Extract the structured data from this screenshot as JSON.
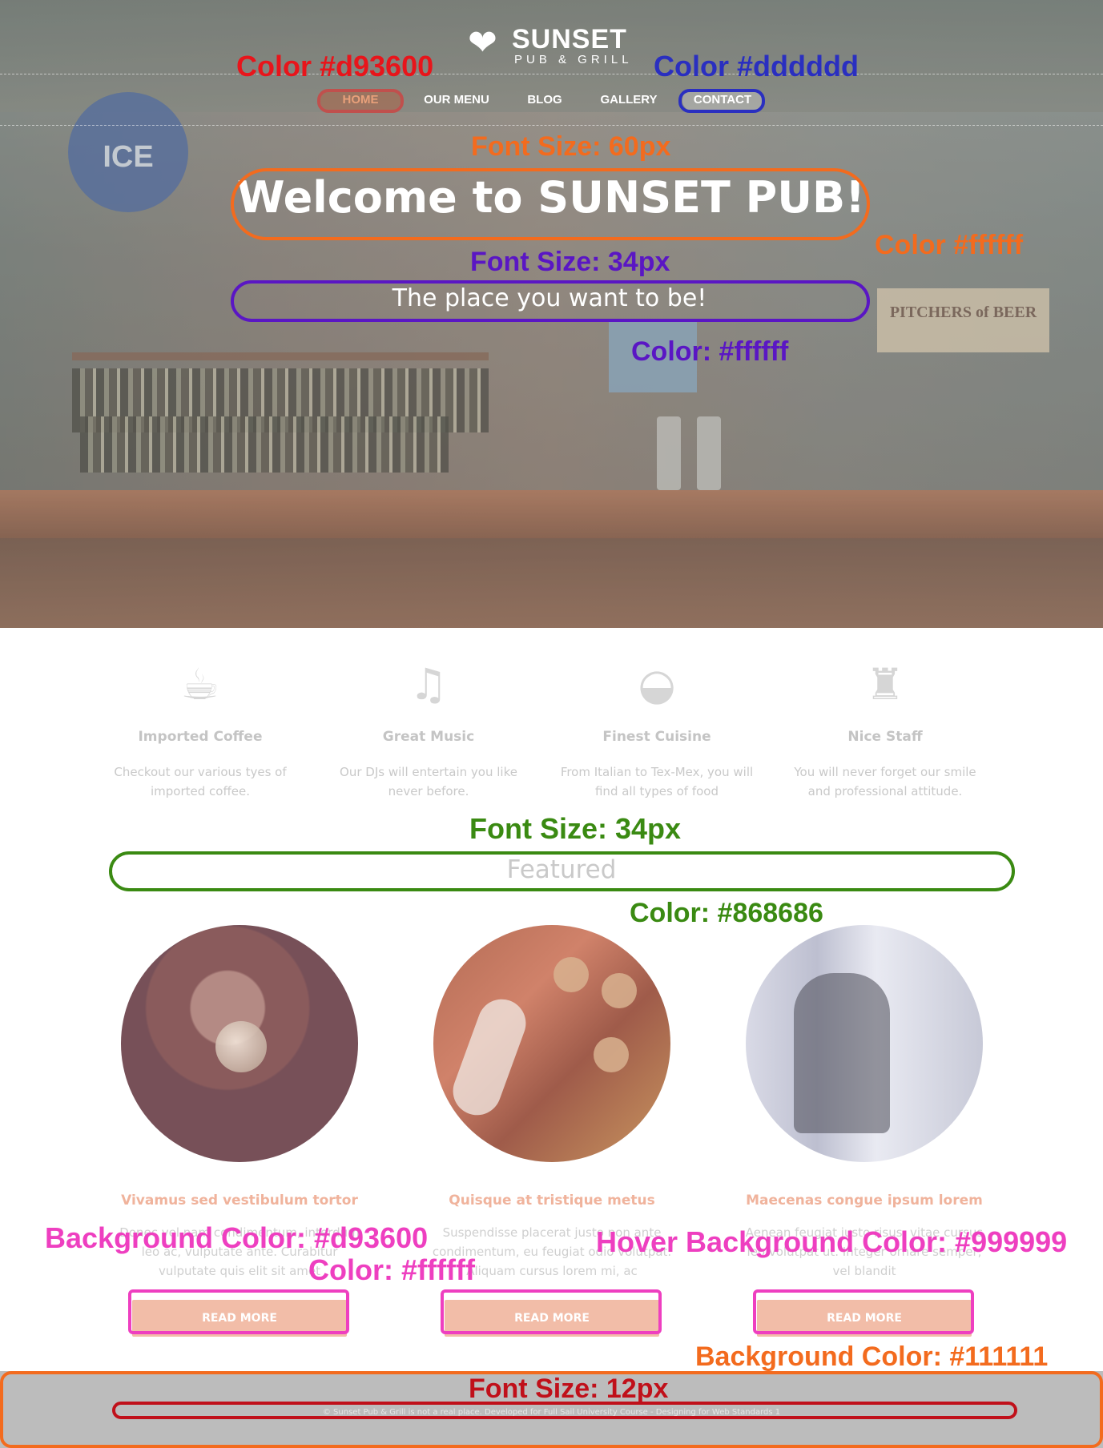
{
  "logo": {
    "brand": "SUNSET",
    "sub": "PUB & GRILL",
    "icon": "heart-fork-icon"
  },
  "nav": {
    "items": [
      {
        "label": "HOME"
      },
      {
        "label": "OUR MENU"
      },
      {
        "label": "BLOG"
      },
      {
        "label": "GALLERY"
      },
      {
        "label": "CONTACT"
      }
    ]
  },
  "hero": {
    "title": "Welcome to SUNSET PUB!",
    "subtitle": "The place you want to be!",
    "sign_ice": "ICE",
    "sign_pitchers": "PITCHERS of BEER"
  },
  "annotations": {
    "nav_active_color": "Color #d93600",
    "nav_hover_color": "Color #dddddd",
    "title_font_size": "Font Size: 60px",
    "title_color": "Color #ffffff",
    "subtitle_font_size": "Font Size: 34px",
    "subtitle_color": "Color: #ffffff",
    "featured_font_size": "Font Size: 34px",
    "featured_color": "Color: #868686",
    "button_bg": "Background Color: #d93600",
    "button_color": "Color: #ffffff",
    "button_hover_bg": "Hover Background Color: #999999",
    "footer_bg": "Background Color: #111111",
    "footer_font_size": "Font Size: 12px"
  },
  "features": [
    {
      "icon": "coffee-cup-icon",
      "title": "Imported Coffee",
      "desc": "Checkout our various tyes of imported coffee."
    },
    {
      "icon": "music-note-icon",
      "title": "Great Music",
      "desc": "Our DJs will entertain you like never before."
    },
    {
      "icon": "food-bowl-icon",
      "title": "Finest Cuisine",
      "desc": "From Italian to Tex-Mex, you will find all types of food"
    },
    {
      "icon": "waiter-icon",
      "title": "Nice Staff",
      "desc": "You will never forget our smile and professional attitude."
    }
  ],
  "featured": {
    "title": "Featured"
  },
  "cards": [
    {
      "title": "Vivamus sed vestibulum tortor",
      "desc": "Donec vel nam condimentum, interdum leo ac, vulputate ante. Curabitur vulputate quis elit sit amet",
      "button": "READ MORE"
    },
    {
      "title": "Quisque at tristique metus",
      "desc": "Suspendisse placerat justo non ante condimentum, eu feugiat odio volutpat. Aliquam cursus lorem mi, ac",
      "button": "READ MORE"
    },
    {
      "title": "Maecenas congue ipsum lorem",
      "desc": "Aenean feugiat justo risus, vitae cursus leo volutpat ut. Integer ornare semper, vel blandit",
      "button": "READ MORE"
    }
  ],
  "footer": {
    "text": "© Sunset Pub & Grill is not a real place. Developed for Full Sail University Course - Designing for Web Standards 1"
  },
  "colors": {
    "accent": "#d93600",
    "nav_hover": "#dddddd",
    "featured": "#868686",
    "button_hover": "#999999",
    "footer_bg": "#111111"
  }
}
